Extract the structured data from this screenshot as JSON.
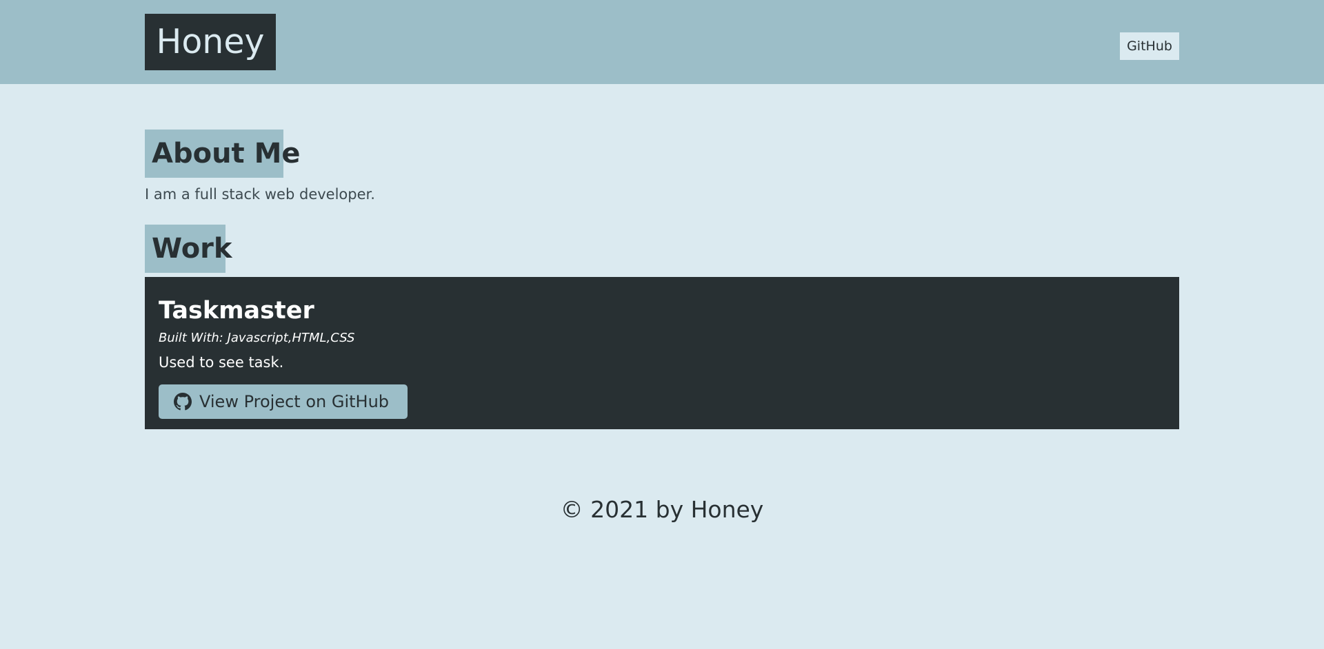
{
  "header": {
    "brand": "Honey",
    "nav_link": "GitHub"
  },
  "about": {
    "heading": "About Me",
    "text": "I am a full stack web developer."
  },
  "work": {
    "heading": "Work",
    "project": {
      "title": "Taskmaster",
      "tech": "Built With: Javascript,HTML,CSS",
      "description": "Used to see task.",
      "button_label": "View Project on GitHub",
      "button_icon": "github-icon"
    }
  },
  "footer": {
    "copyright": "© 2021 by Honey"
  },
  "colors": {
    "background": "#dbeaf0",
    "header": "#9cbec8",
    "dark": "#283033",
    "accent": "#9cbec8"
  }
}
